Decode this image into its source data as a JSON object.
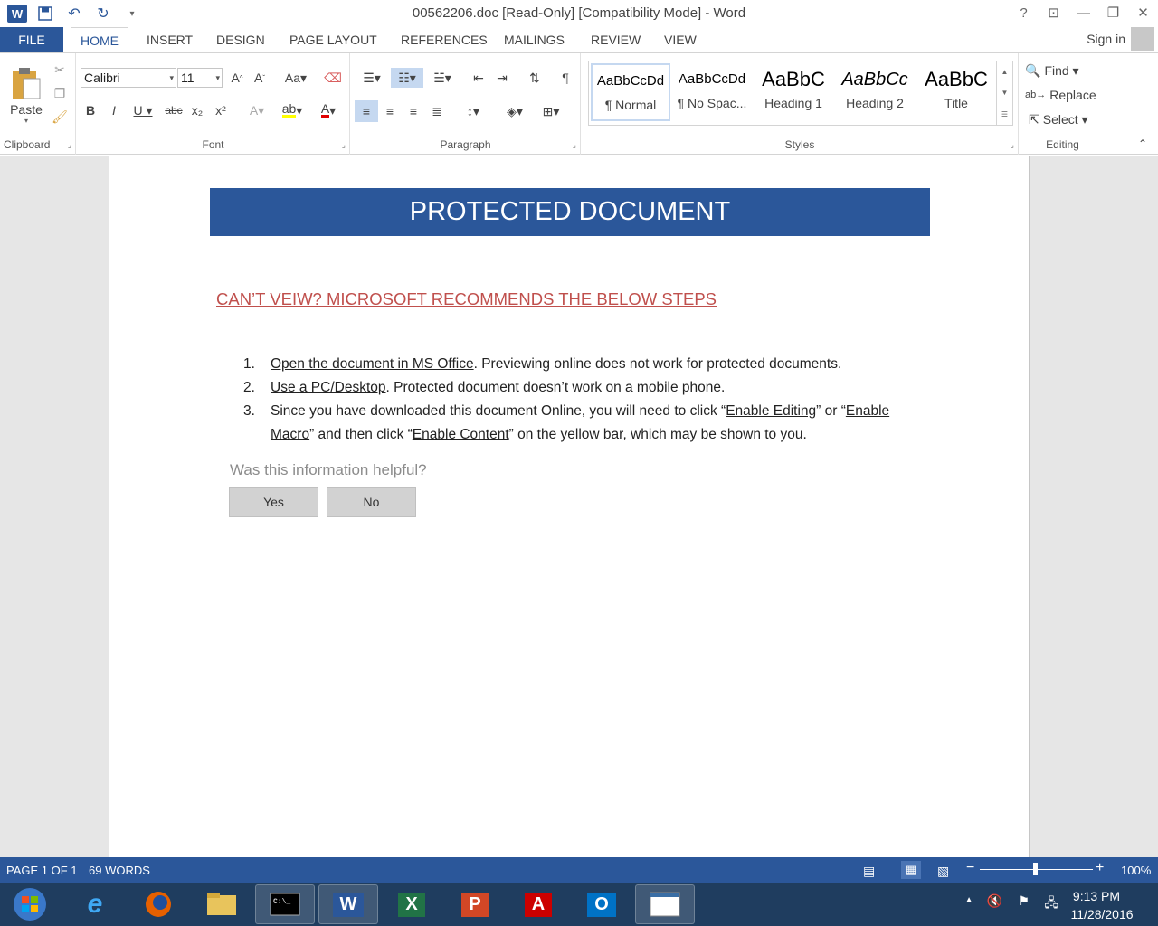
{
  "window": {
    "title": "00562206.doc [Read-Only] [Compatibility Mode] - Word",
    "app_icon_letter": "W"
  },
  "tabs": [
    "FILE",
    "HOME",
    "INSERT",
    "DESIGN",
    "PAGE LAYOUT",
    "REFERENCES",
    "MAILINGS",
    "REVIEW",
    "VIEW"
  ],
  "account": {
    "sign_in": "Sign in"
  },
  "ribbon": {
    "clipboard": {
      "label": "Clipboard",
      "paste": "Paste"
    },
    "font": {
      "label": "Font",
      "family": "Calibri",
      "size": "11"
    },
    "paragraph": {
      "label": "Paragraph"
    },
    "styles": {
      "label": "Styles",
      "items": [
        {
          "sample": "AaBbCcDd",
          "name": "¶ Normal"
        },
        {
          "sample": "AaBbCcDd",
          "name": "¶ No Spac..."
        },
        {
          "sample": "AaBbC",
          "name": "Heading 1"
        },
        {
          "sample": "AaBbCc",
          "name": "Heading 2"
        },
        {
          "sample": "AaBbC",
          "name": "Title"
        }
      ]
    },
    "editing": {
      "label": "Editing",
      "find": "Find",
      "replace": "Replace",
      "select": "Select"
    }
  },
  "document": {
    "banner": "PROTECTED DOCUMENT",
    "heading": "CAN’T VEIW? MICROSOFT RECOMMENDS THE BELOW STEPS",
    "steps": [
      {
        "num": "1.",
        "link": "Open the document in MS Office",
        "rest": ". Previewing online does not work for protected documents."
      },
      {
        "num": "2.",
        "link": "Use a PC/Desktop",
        "rest": ". Protected document doesn’t work on a mobile phone."
      }
    ],
    "step3": {
      "num": "3.",
      "part1": "Since you have downloaded this document Online, you will need to click “",
      "link1": "Enable Editing",
      "part2": "” or “",
      "link2": "Enable Macro",
      "part3": "” and then click “",
      "link3": "Enable Content",
      "part4": "” on the yellow bar, which may be shown to you."
    },
    "helpful_question": "Was this information helpful?",
    "yes": "Yes",
    "no": "No"
  },
  "status": {
    "page": "PAGE 1 OF 1",
    "words": "69 WORDS",
    "zoom": "100%"
  },
  "tray": {
    "time": "9:13 PM",
    "date": "11/28/2016"
  },
  "colors": {
    "brand": "#2b579a",
    "heading": "#c0504d",
    "taskbar": "#1f3d5f"
  }
}
